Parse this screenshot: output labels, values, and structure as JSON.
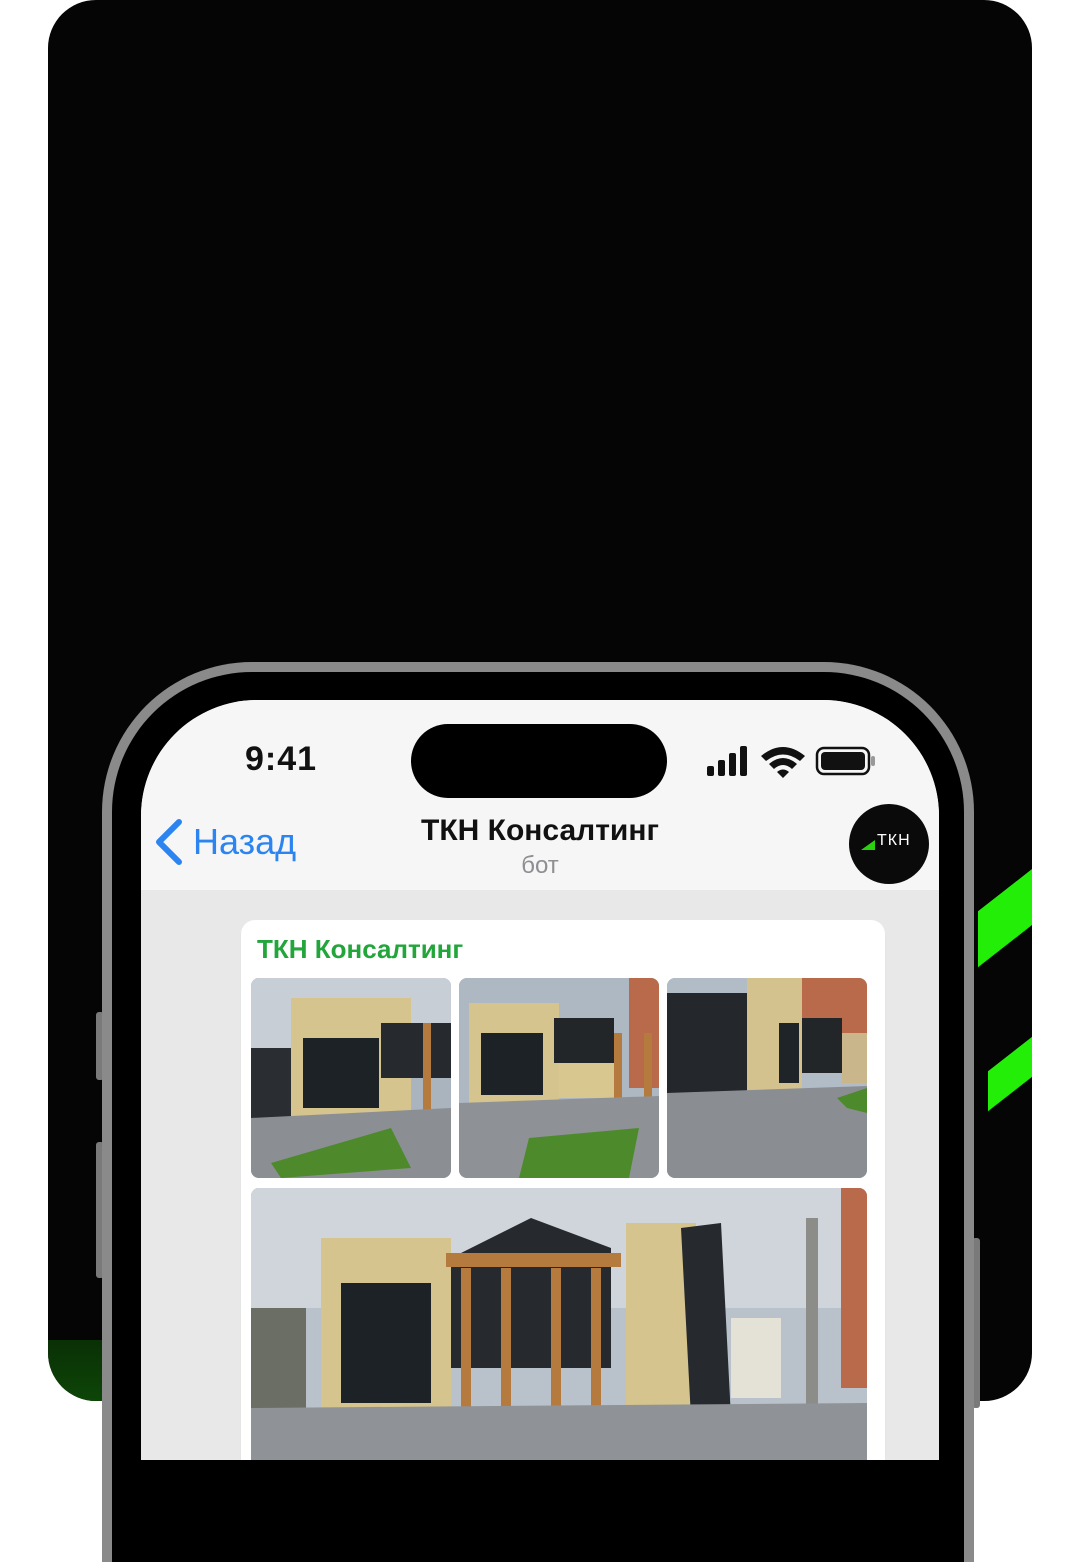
{
  "status_bar": {
    "time": "9:41"
  },
  "chat_header": {
    "back_label": "Назад",
    "title": "ТКН Консалтинг",
    "subtitle": "бот",
    "avatar_logo": "ТКН"
  },
  "message": {
    "sender": "ТКН Консалтинг",
    "photos": [
      {
        "alt": "building-photo-1"
      },
      {
        "alt": "building-photo-2"
      },
      {
        "alt": "building-photo-3"
      },
      {
        "alt": "building-photo-4"
      }
    ]
  },
  "colors": {
    "accent_green": "#22ee08",
    "link_blue": "#2b84f0",
    "sender_green": "#22a53a"
  }
}
